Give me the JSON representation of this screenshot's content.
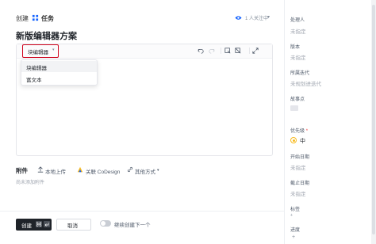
{
  "header": {
    "create": "创建",
    "type": "任务",
    "followers": "1 人关注中",
    "follow_chevron": "▾"
  },
  "title": "新版编辑器方案",
  "editor": {
    "mode_label": "块编辑器",
    "mode_chevron": "▾",
    "dropdown_options": [
      "块编辑器",
      "富文本"
    ],
    "selected_option": "块编辑器"
  },
  "attachments": {
    "title": "附件",
    "local_upload": "本地上传",
    "codesign": "关联 CoDesign",
    "other": "其他方式",
    "other_chevron": "▾",
    "empty": "尚未添加附件"
  },
  "footer": {
    "create": "创建",
    "cancel": "取消",
    "continue": "继续创建下一个"
  },
  "sidebar": {
    "assignee_label": "处理人",
    "assignee_value": "未指定",
    "version_label": "版本",
    "version_value": "未指定",
    "iteration_label": "所属迭代",
    "iteration_value": "未规划进迭代",
    "story_points_label": "故事点",
    "priority_label": "优先级",
    "priority_required": "*",
    "priority_value": "中",
    "start_label": "开始日期",
    "start_value": "未指定",
    "due_label": "截止日期",
    "due_value": "未指定",
    "tags_label": "标签",
    "tags_add": "+",
    "progress_label": "进度"
  },
  "colors": {
    "accent": "#1664ff",
    "highlight_border": "#d0021b",
    "primary_button": "#1f2329",
    "priority": "#f7ba1e"
  }
}
